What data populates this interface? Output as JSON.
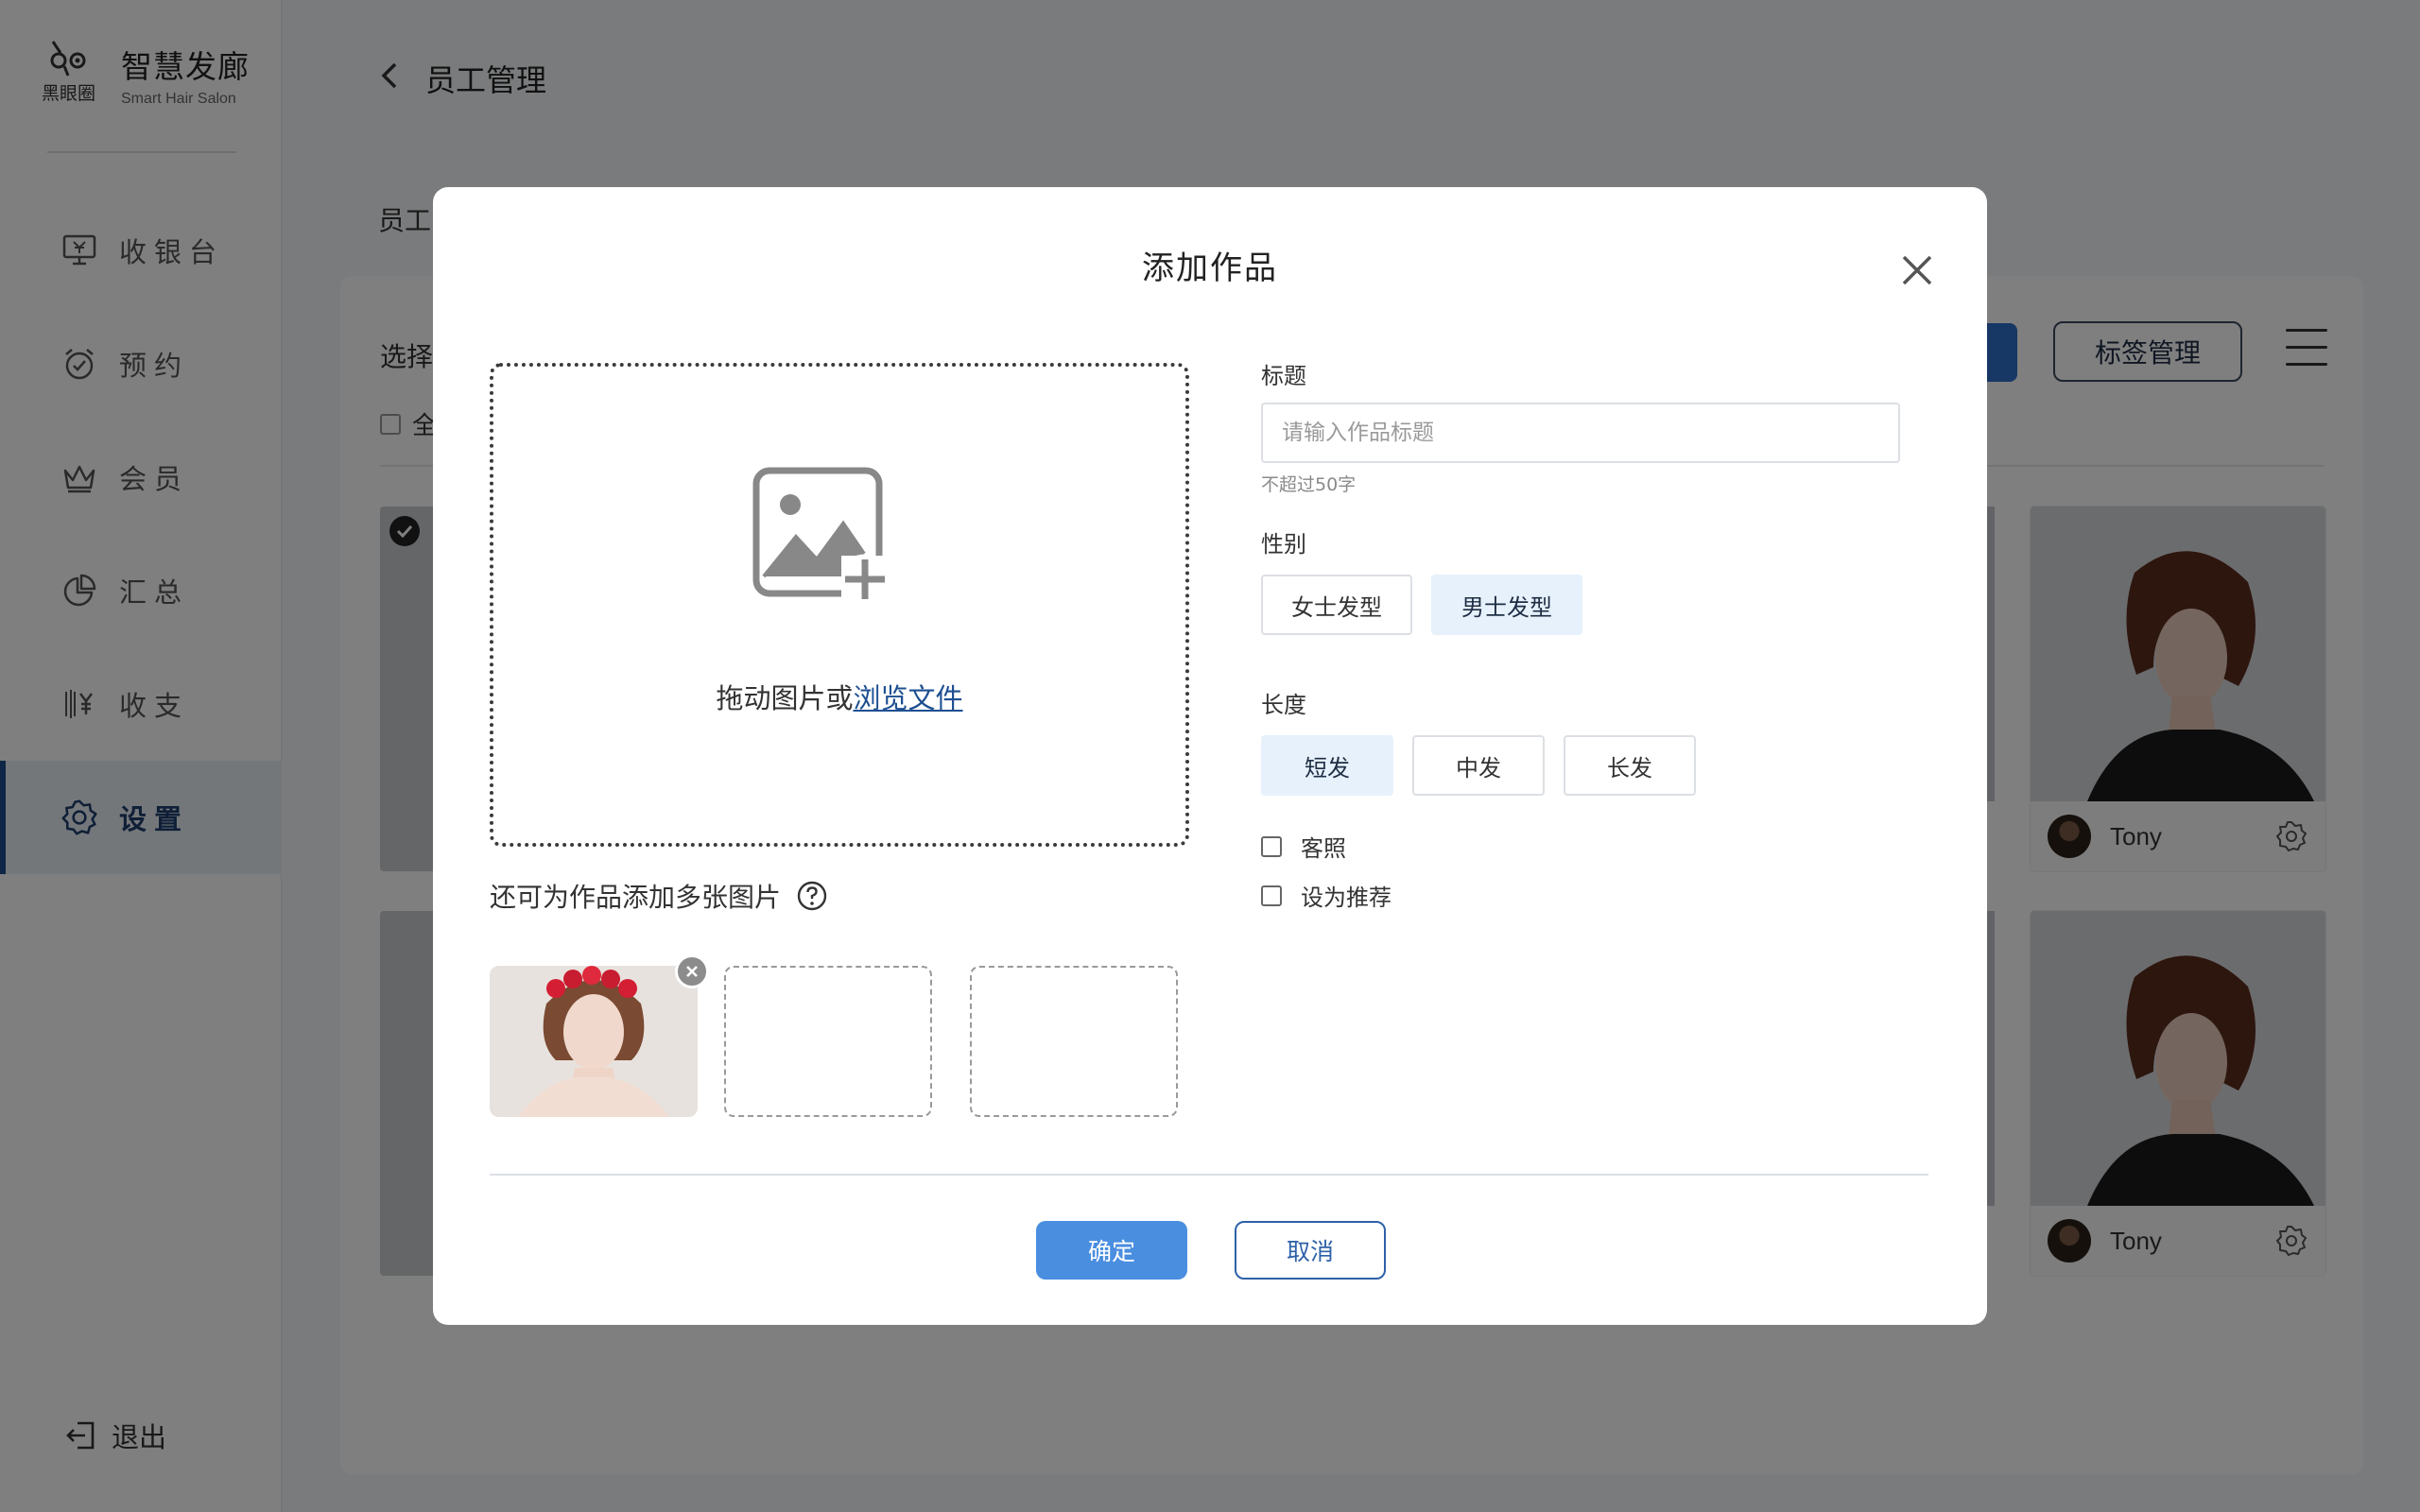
{
  "brand": {
    "logo_sub": "黑眼圈",
    "title": "智慧发廊",
    "subtitle": "Smart Hair Salon"
  },
  "sidebar": {
    "items": [
      {
        "label": "收银台",
        "icon": "cashier-monitor-icon",
        "active": false
      },
      {
        "label": "预约",
        "icon": "alarm-clock-icon",
        "active": false
      },
      {
        "label": "会员",
        "icon": "crown-icon",
        "active": false
      },
      {
        "label": "汇总",
        "icon": "pie-chart-icon",
        "active": false
      },
      {
        "label": "收支",
        "icon": "yen-ledger-icon",
        "active": false
      },
      {
        "label": "设置",
        "icon": "gear-icon",
        "active": true
      }
    ],
    "logout_label": "退出"
  },
  "header": {
    "title": "员工管理",
    "section_label": "员工"
  },
  "content": {
    "select_label": "选择",
    "select_all_label": "全",
    "tag_manage_label": "标签管理",
    "cards": [
      {
        "name": "Tony"
      },
      {
        "name": "Tony"
      }
    ]
  },
  "modal": {
    "title": "添加作品",
    "dropzone_text": "拖动图片或",
    "browse_link": "浏览文件",
    "more_images_label": "还可为作品添加多张图片",
    "title_label": "标题",
    "title_placeholder": "请输入作品标题",
    "title_value": "",
    "title_hint": "不超过50字",
    "gender_label": "性别",
    "gender_options": [
      {
        "label": "女士发型",
        "selected": false
      },
      {
        "label": "男士发型",
        "selected": true
      }
    ],
    "length_label": "长度",
    "length_options": [
      {
        "label": "短发",
        "selected": true
      },
      {
        "label": "中发",
        "selected": false
      },
      {
        "label": "长发",
        "selected": false
      }
    ],
    "checkbox_client_photo": {
      "label": "客照",
      "checked": false
    },
    "checkbox_recommend": {
      "label": "设为推荐",
      "checked": false
    },
    "confirm_label": "确定",
    "cancel_label": "取消"
  },
  "colors": {
    "primary": "#4a8ee0",
    "primary_dark": "#2e62a8",
    "selected_bg": "#e6f1fb",
    "link": "#1d4f91",
    "active_nav_bar": "#1e4d8c"
  }
}
